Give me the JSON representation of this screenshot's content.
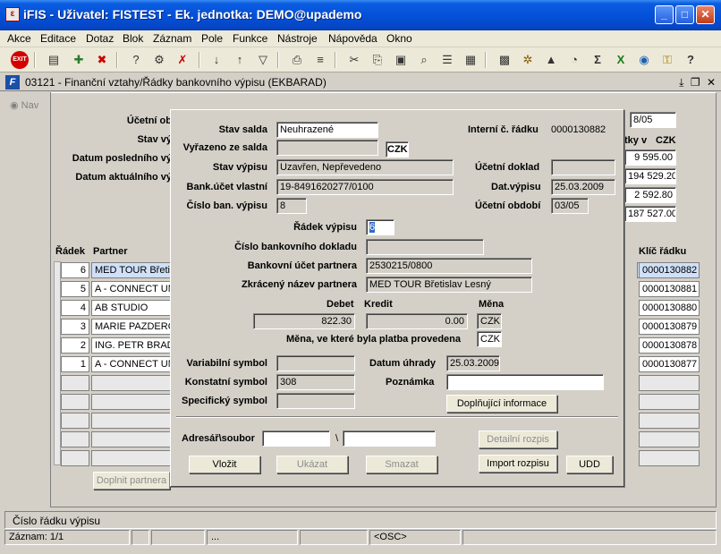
{
  "window": {
    "title": "iFIS - Uživatel: FISTEST - Ek. jednotka: DEMO@upademo",
    "app_icon": "ifis-app-icon",
    "buttons": [
      "_",
      "□",
      "✕"
    ]
  },
  "menu": [
    "Akce",
    "Editace",
    "Dotaz",
    "Blok",
    "Záznam",
    "Pole",
    "Funkce",
    "Nástroje",
    "Nápověda",
    "Okno"
  ],
  "toolbar": {
    "exit_label": "EXIT",
    "icons": [
      "save-icon",
      "add-record-icon",
      "delete-record-icon",
      "query-icon",
      "execute-query-icon",
      "cancel-query-icon",
      "sort-asc-icon",
      "sort-desc-icon",
      "filter-icon",
      "print-icon",
      "cut-icon",
      "copy-icon",
      "paste-icon",
      "find-icon",
      "list-icon",
      "tree-icon",
      "calculator-icon",
      "settings-icon",
      "chart-icon",
      "clock-icon",
      "sum-icon",
      "excel-icon",
      "web-icon",
      "help-key-icon",
      "help-icon"
    ]
  },
  "form": {
    "title": "03121 - Finanční vztahy/Řádky bankovního výpisu (EKBARAD)",
    "nav_label": "Nav",
    "bg_labels": [
      "Účetní ob",
      "Stav vý",
      "Datum posledního vý",
      "Datum aktuálního vý"
    ],
    "bg_period": "8/05",
    "bg_header_right": "tky v",
    "bg_header_currency": "CZK",
    "bg_amounts": [
      "9 595.00",
      "194 529.20",
      "2 592.80",
      "187 527.00"
    ],
    "grid_headers": {
      "radek": "Řádek",
      "partner": "Partner",
      "klic": "Klíč řádku"
    },
    "rows": [
      {
        "radek": "6",
        "partner": "MED TOUR Břetisla",
        "klic": "0000130882"
      },
      {
        "radek": "5",
        "partner": "A - CONNECT UNE",
        "klic": "0000130881"
      },
      {
        "radek": "4",
        "partner": "AB STUDIO",
        "klic": "0000130880"
      },
      {
        "radek": "3",
        "partner": "MARIE PAZDEROV",
        "klic": "0000130879"
      },
      {
        "radek": "2",
        "partner": "ING. PETR BRADA",
        "klic": "0000130878"
      },
      {
        "radek": "1",
        "partner": "A - CONNECT UNE",
        "klic": "0000130877"
      }
    ],
    "doplnit_partnera": "Doplnit partnera"
  },
  "dialog": {
    "stav_salda_label": "Stav salda",
    "stav_salda": "Neuhrazené",
    "interni_label": "Interní č. řádku",
    "interni": "0000130882",
    "vyrazeno_label": "Vyřazeno ze salda",
    "vyrazeno": "",
    "vyrazeno_mena": "CZK",
    "stav_vypisu_label": "Stav výpisu",
    "stav_vypisu": "Uzavřen, Nepřevedeno",
    "ucetni_doklad_label": "Účetní doklad",
    "ucetni_doklad": "",
    "bank_ucet_label": "Bank.účet vlastní",
    "bank_ucet": "19-8491620277/0100",
    "dat_vypisu_label": "Dat.výpisu",
    "dat_vypisu": "25.03.2009",
    "cislo_ban_label": "Číslo ban. výpisu",
    "cislo_ban": "8",
    "ucetni_obdobi_label": "Účetní období",
    "ucetni_obdobi": "03/05",
    "radek_vypisu_label": "Řádek výpisu",
    "radek_vypisu": "6",
    "cislo_dokladu_label": "Číslo bankovního dokladu",
    "cislo_dokladu": "",
    "ucet_partnera_label": "Bankovní účet partnera",
    "ucet_partnera": "2530215/0800",
    "zkraceny_label": "Zkrácený název partnera",
    "zkraceny": "MED TOUR Břetislav Lesný",
    "debet_label": "Debet",
    "kredit_label": "Kredit",
    "mena_label": "Měna",
    "debet": "822.30",
    "kredit": "0.00",
    "mena": "CZK",
    "mena_platby_label": "Měna, ve které byla platba provedena",
    "mena_platby": "CZK",
    "vs_label": "Variabilní symbol",
    "vs": "",
    "datum_uhrady_label": "Datum úhrady",
    "datum_uhrady": "25.03.2009",
    "ks_label": "Konstatní symbol",
    "ks": "308",
    "poznamka_label": "Poznámka",
    "poznamka": "",
    "ss_label": "Specifický symbol",
    "ss": "",
    "doplnujici_btn": "Doplňující informace",
    "adresar_label": "Adresář\\soubor",
    "adresar": "",
    "sep": "\\",
    "soubor": "",
    "detailni_btn": "Detailní rozpis",
    "vlozit_btn": "Vložit",
    "ukazat_btn": "Ukázat",
    "smazat_btn": "Smazat",
    "import_btn": "Import rozpisu",
    "udd_btn": "UDD"
  },
  "status": {
    "hint": "Číslo řádku výpisu",
    "zaznam": "Záznam: 1/1",
    "dots": "...",
    "osc": "<OSC>"
  }
}
